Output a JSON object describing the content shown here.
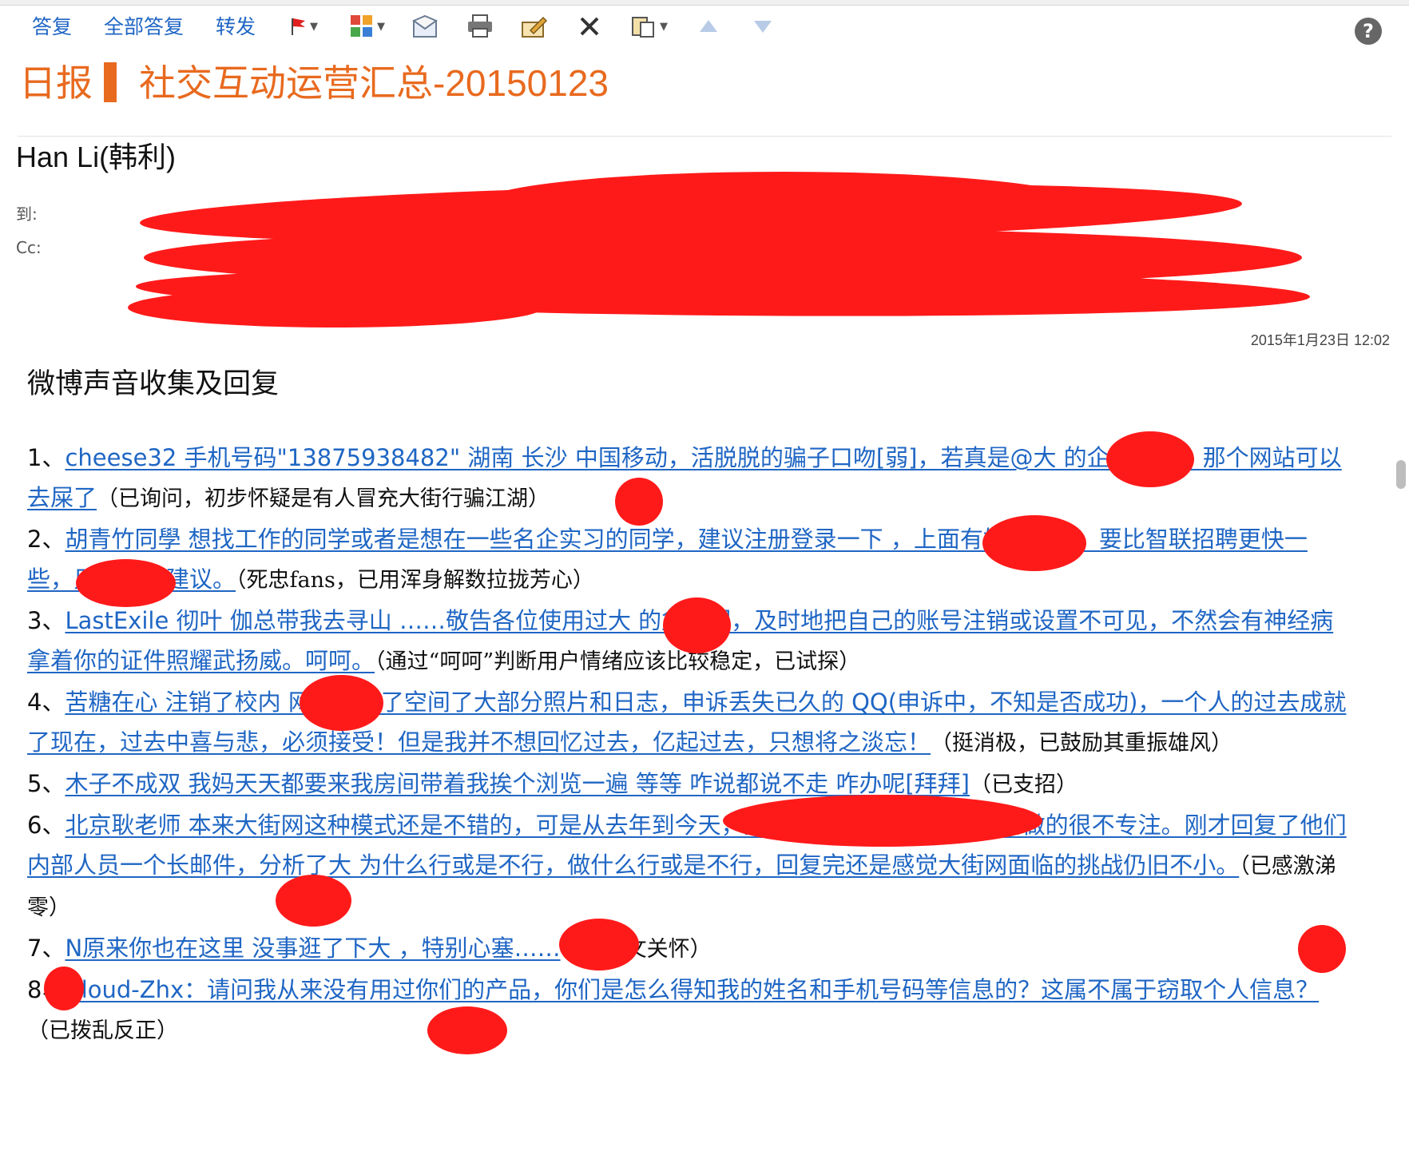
{
  "toolbar": {
    "reply": "答复",
    "reply_all": "全部答复",
    "forward": "转发"
  },
  "subject": {
    "prefix": "日报",
    "title": "社交互动运营汇总-20150123"
  },
  "header": {
    "sender": "Han Li(韩利)",
    "to_label": "到:",
    "cc_label": "Cc:",
    "date": "2015年1月23日 12:02"
  },
  "body": {
    "section_title": "微博声音收集及回复",
    "items": [
      {
        "num": "1、",
        "text": "cheese32  手机号码\"13875938482\" 湖南 长沙 中国移动，活脱脱的骗子口吻[弱]，若真是@大   的企业客服，那个网站可以去屎了",
        "note": "（已询问，初步怀疑是有人冒充大街行骗江湖）"
      },
      {
        "num": "2、",
        "text": "胡青竹同學  想找工作的同学或者是想在一些名企实习的同学，建议注册登录一下        ，上面有好多机会，要比智联招聘更快一些，只是个人建议。",
        "note": "（死忠fans，已用浑身解数拉拢芳心）"
      },
      {
        "num": "3、",
        "text": "LastExile 彻叶 伽总带我去寻山 ……敬告各位使用过大     的盆友们，及时地把自己的账号注销或设置不可见，不然会有神经病拿着你的证件照耀武扬威。呵呵。",
        "note": "（通过“呵呵”判断用户情绪应该比较稳定，已试探）"
      },
      {
        "num": "4、",
        "text": "苦糖在心  注销了校内      网，删除了空间了大部分照片和日志，申诉丢失已久的 QQ(申诉中，不知是否成功)，一个人的过去成就了现在，过去中喜与悲，必须接受！但是我并不想回忆过去，亿起过去，只想将之淡忘！",
        "note": "（挺消极，已鼓励其重振雄风）"
      },
      {
        "num": "5、",
        "text": "木子不成双  我妈天天都要来我房间带着我挨个浏览一遍                         等等 咋说都说不走 咋办呢[拜拜]",
        "note": "（已支招）"
      },
      {
        "num": "6、",
        "text": "北京耿老师  本来大街网这种模式还是不错的，可是从去年到今天，产品没有进步，具体业务也做的很不专注。刚才回复了他们内部人员一个长邮件，分析了大      为什么行或是不行，做什么行或是不行，回复完还是感觉大街网面临的挑战仍旧不小。",
        "note": "（已感激涕零）"
      },
      {
        "num": "7、",
        "text": "N原来你也在这里  没事逛了下大      ，特别心塞……",
        "note": "（已人文关怀）"
      },
      {
        "num": "8、",
        "text": "Cloud-Zhx：请问我从来没有用过你们的产品，你们是怎么得知我的姓名和手机号码等信息的？这属不属于窃取个人信息？",
        "note": "（已拨乱反正）"
      }
    ]
  },
  "colors": {
    "link": "#1f66c4",
    "subject": "#e86a1f",
    "redaction": "#ff1a1a"
  },
  "icons": [
    "flag-icon",
    "categorize-icon",
    "mark-read-icon",
    "print-icon",
    "compose-icon",
    "delete-icon",
    "move-icon",
    "prev-icon",
    "next-icon",
    "help-icon"
  ]
}
